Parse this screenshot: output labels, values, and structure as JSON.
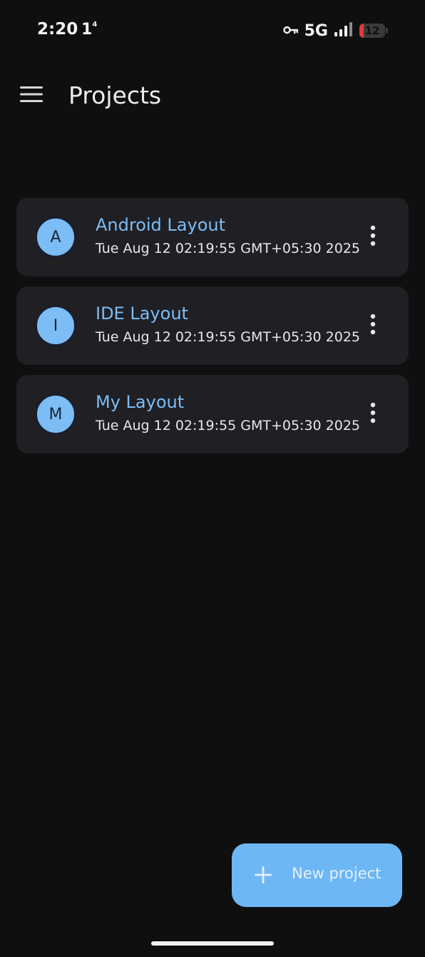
{
  "status_bar": {
    "time": "2:20",
    "notification": "1",
    "notification_sup": "4",
    "network": "5G",
    "battery": "12",
    "key_icon": "key-icon",
    "signal_icon": "signal-bars-icon",
    "battery_icon": "battery-icon"
  },
  "app_bar": {
    "title": "Projects",
    "menu_icon": "hamburger-menu-icon"
  },
  "projects": [
    {
      "initial": "A",
      "name": "Android Layout",
      "date": "Tue Aug 12 02:19:55 GMT+05:30 2025"
    },
    {
      "initial": "I",
      "name": "IDE Layout",
      "date": "Tue Aug 12 02:19:55 GMT+05:30 2025"
    },
    {
      "initial": "M",
      "name": "My Layout",
      "date": "Tue Aug 12 02:19:55 GMT+05:30 2025"
    }
  ],
  "fab": {
    "label": "New project",
    "icon": "plus-icon"
  },
  "colors": {
    "background": "#0f0f10",
    "card": "#1f1f24",
    "accent": "#7cbdf6",
    "fab": "#6db7f5",
    "battery_low": "#e53935"
  }
}
